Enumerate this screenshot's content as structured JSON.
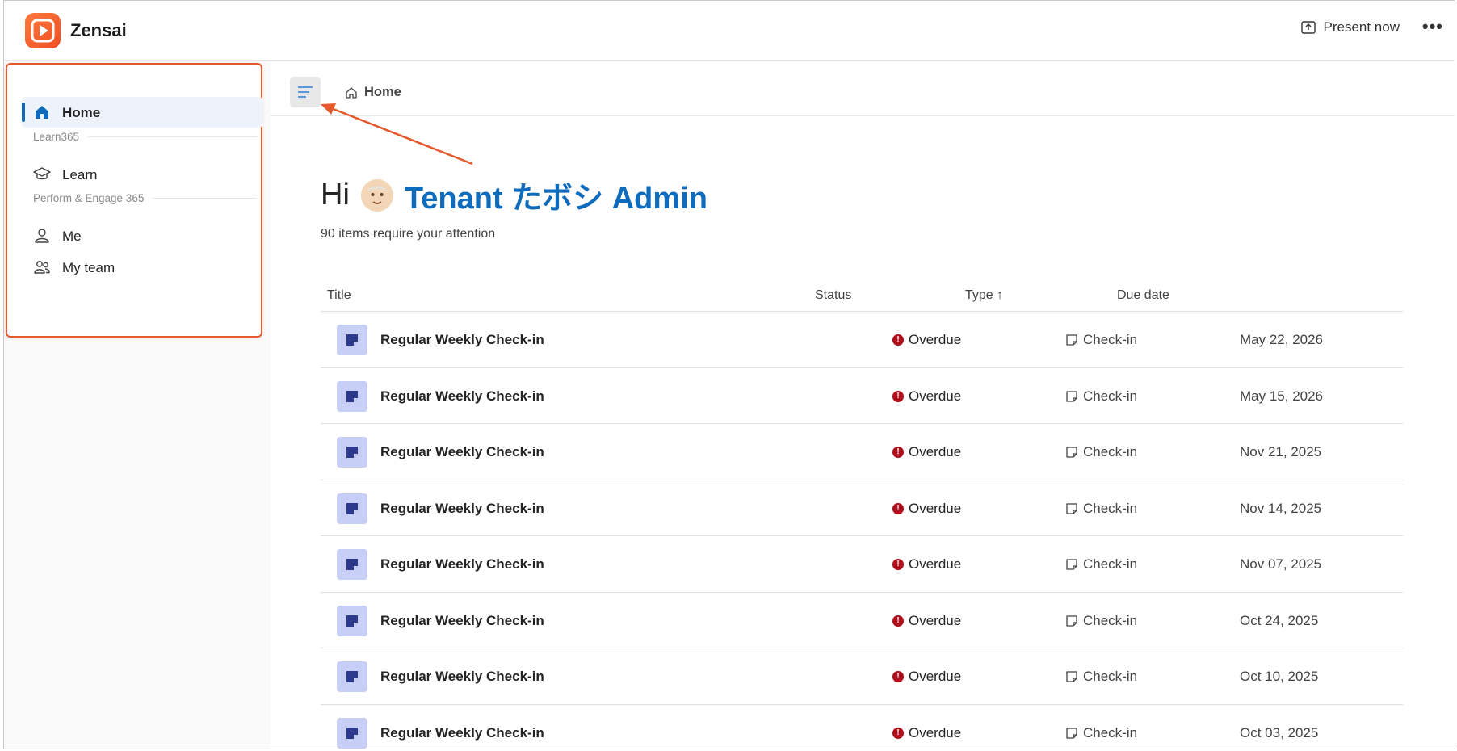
{
  "app": {
    "brand": "Zensai",
    "present_label": "Present now",
    "more_label": "•••"
  },
  "sidebar": {
    "home_label": "Home",
    "section_learn": "Learn365",
    "learn_label": "Learn",
    "section_perform": "Perform & Engage 365",
    "me_label": "Me",
    "my_team_label": "My team"
  },
  "breadcrumb": {
    "home_label": "Home"
  },
  "greeting": {
    "hi": "Hi",
    "name": "Tenant たボシ Admin",
    "subtitle": "90 items require your attention"
  },
  "table": {
    "columns": {
      "title": "Title",
      "status": "Status",
      "type": "Type ↑",
      "due": "Due date"
    },
    "rows": [
      {
        "title": "Regular Weekly Check-in",
        "status": "Overdue",
        "type": "Check-in",
        "due": "May 22, 2026"
      },
      {
        "title": "Regular Weekly Check-in",
        "status": "Overdue",
        "type": "Check-in",
        "due": "May 15, 2026"
      },
      {
        "title": "Regular Weekly Check-in",
        "status": "Overdue",
        "type": "Check-in",
        "due": "Nov 21, 2025"
      },
      {
        "title": "Regular Weekly Check-in",
        "status": "Overdue",
        "type": "Check-in",
        "due": "Nov 14, 2025"
      },
      {
        "title": "Regular Weekly Check-in",
        "status": "Overdue",
        "type": "Check-in",
        "due": "Nov 07, 2025"
      },
      {
        "title": "Regular Weekly Check-in",
        "status": "Overdue",
        "type": "Check-in",
        "due": "Oct 24, 2025"
      },
      {
        "title": "Regular Weekly Check-in",
        "status": "Overdue",
        "type": "Check-in",
        "due": "Oct 10, 2025"
      },
      {
        "title": "Regular Weekly Check-in",
        "status": "Overdue",
        "type": "Check-in",
        "due": "Oct 03, 2025"
      }
    ]
  },
  "colors": {
    "brand": "#f04e23",
    "accent": "#0f6cbd",
    "highlight": "#e45a2c",
    "overdue": "#b10e1c"
  }
}
